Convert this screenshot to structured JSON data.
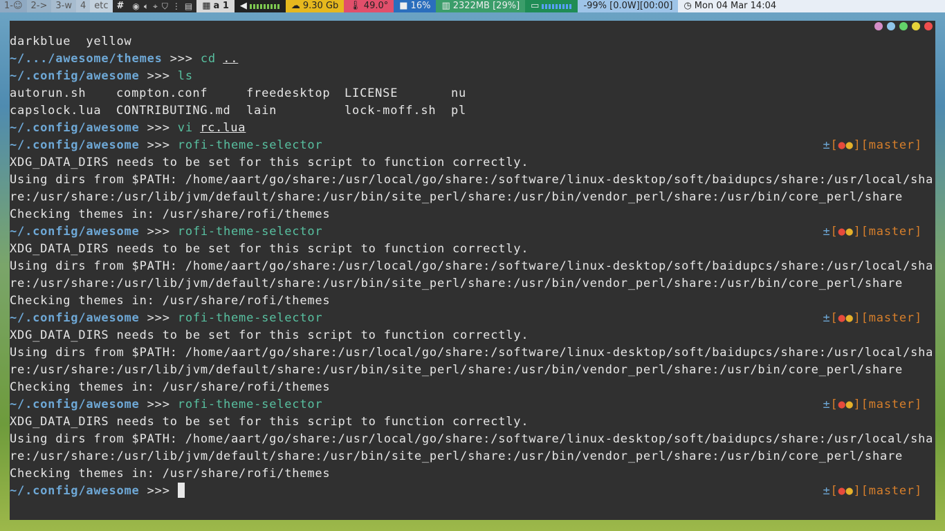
{
  "topbar": {
    "tags": [
      "1-☺",
      "2->",
      "3-w",
      "4",
      "etc",
      "#"
    ],
    "layout_label": "a 1",
    "disk": "9.30 Gb",
    "temp": "49.0°",
    "cpu": "16%",
    "mem": "2322MB [29%]",
    "battery": "-99% [0.0W][00:00]",
    "clock": "Mon 04 Mar  14:04"
  },
  "terminal": {
    "line_colors_top": "darkblue  yellow",
    "prompt_themes_path": "~/.../awesome/themes",
    "prompt_path": "~/.config/awesome",
    "prompt_sym": " >>> ",
    "cmd_cd": "cd",
    "arg_cd": "..",
    "cmd_ls": "ls",
    "ls_row1": [
      "autorun.sh",
      "compton.conf",
      "freedesktop",
      "LICENSE",
      "nu"
    ],
    "ls_row2": [
      "capslock.lua",
      "CONTRIBUTING.md",
      "lain",
      "lock-moff.sh",
      "pl"
    ],
    "cmd_vi": "vi",
    "arg_vi": "rc.lua",
    "cmd_rofi": "rofi-theme-selector",
    "git_plus": "±",
    "git_open": "[",
    "git_dot": "●",
    "git_close": "]",
    "git_branch": "[master]",
    "out_xdg": "XDG_DATA_DIRS needs to be set for this script to function correctly.",
    "out_dirs1": "Using dirs from $PATH: /home/aart/go/share:/usr/local/go/share:/software/linux-desktop/soft/baidupcs/share:/usr/local/sha",
    "out_dirs2": "re:/usr/share:/usr/lib/jvm/default/share:/usr/bin/site_perl/share:/usr/bin/vendor_perl/share:/usr/bin/core_perl/share",
    "out_check": "Checking themes in: /usr/share/rofi/themes"
  }
}
